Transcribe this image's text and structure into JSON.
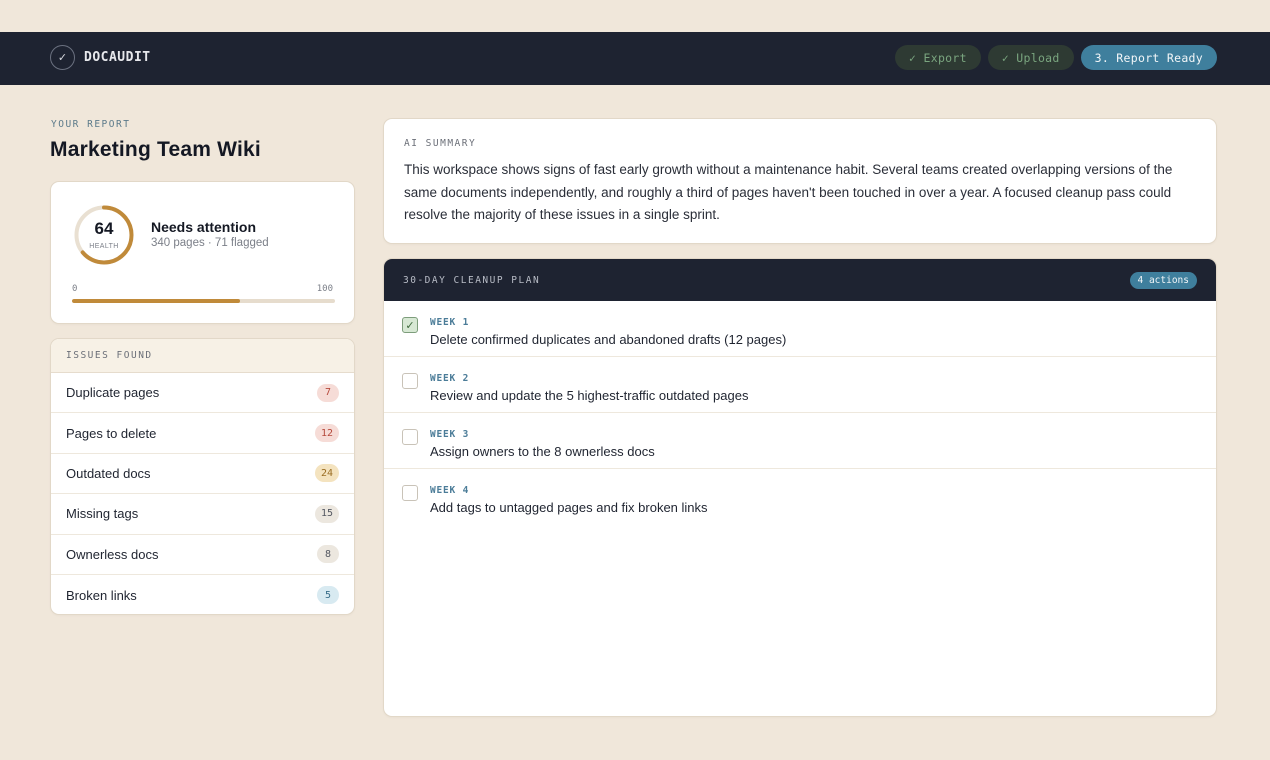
{
  "header": {
    "brand_icon": "check-icon",
    "brand_name": "DOCAUDIT",
    "steps": [
      {
        "label": "✓ Export",
        "state": "done"
      },
      {
        "label": "✓ Upload",
        "state": "done"
      },
      {
        "label": "3. Report Ready",
        "state": "active"
      }
    ]
  },
  "report": {
    "eyebrow": "YOUR REPORT",
    "title": "Marketing Team Wiki"
  },
  "health": {
    "score": "64",
    "score_value": 64,
    "label": "HEALTH",
    "status": "Needs attention",
    "subtitle": "340 pages · 71 flagged",
    "range_min": "0",
    "range_max": "100",
    "accent_color": "#c08a3a"
  },
  "issues": {
    "heading": "ISSUES FOUND",
    "items": [
      {
        "label": "Duplicate pages",
        "count": "7",
        "bg": "#f6dcd7",
        "fg": "#b5493c"
      },
      {
        "label": "Pages to delete",
        "count": "12",
        "bg": "#f6dcd7",
        "fg": "#b5493c"
      },
      {
        "label": "Outdated docs",
        "count": "24",
        "bg": "#f4e3bf",
        "fg": "#9a6d23"
      },
      {
        "label": "Missing tags",
        "count": "15",
        "bg": "#ece7df",
        "fg": "#545862"
      },
      {
        "label": "Ownerless docs",
        "count": "8",
        "bg": "#ece7df",
        "fg": "#545862"
      },
      {
        "label": "Broken links",
        "count": "5",
        "bg": "#d8eaf1",
        "fg": "#3a6f8a"
      }
    ]
  },
  "summary": {
    "eyebrow": "AI SUMMARY",
    "text": "This workspace shows signs of fast early growth without a maintenance habit. Several teams created overlapping versions of the same documents independently, and roughly a third of pages haven't been touched in over a year. A focused cleanup pass could resolve the majority of these issues in a single sprint."
  },
  "plan": {
    "title": "30-DAY CLEANUP PLAN",
    "count_label": "4 actions",
    "tasks": [
      {
        "week": "WEEK 1",
        "text": "Delete confirmed duplicates and abandoned drafts (12 pages)",
        "checked": true
      },
      {
        "week": "WEEK 2",
        "text": "Review and update the 5 highest-traffic outdated pages",
        "checked": false
      },
      {
        "week": "WEEK 3",
        "text": "Assign owners to the 8 ownerless docs",
        "checked": false
      },
      {
        "week": "WEEK 4",
        "text": "Add tags to untagged pages and fix broken links",
        "checked": false
      }
    ]
  }
}
